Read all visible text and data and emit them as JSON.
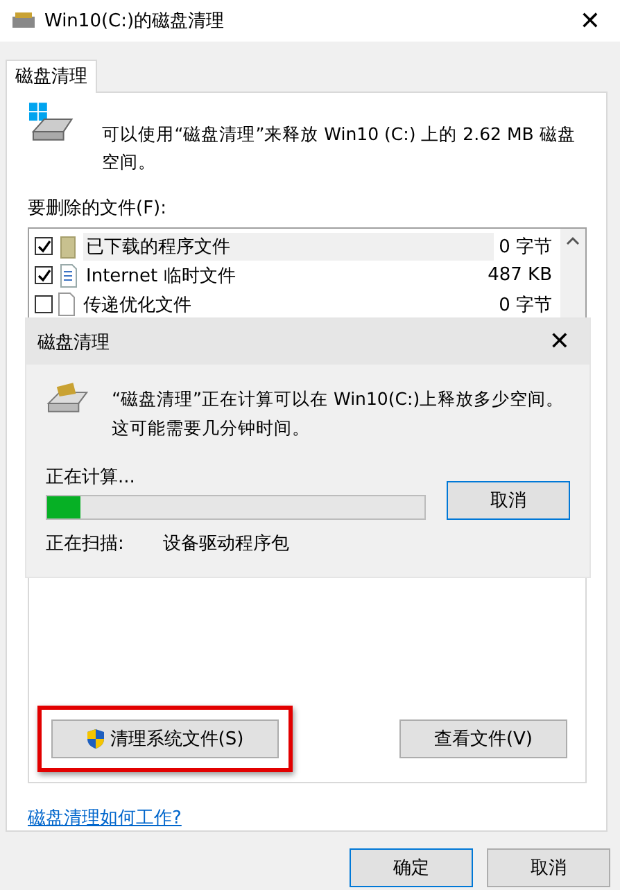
{
  "window": {
    "title": "Win10(C:)的磁盘清理",
    "close": "✕"
  },
  "tabs": [
    {
      "label": "磁盘清理",
      "selected": true
    }
  ],
  "summary": "可以使用“磁盘清理”来释放 Win10 (C:) 上的 2.62 MB 磁盘空间。",
  "files_label": "要删除的文件(F):",
  "files": [
    {
      "name": "已下载的程序文件",
      "size": "0 字节",
      "checked": true,
      "selected": true,
      "kind": "folder"
    },
    {
      "name": "Internet 临时文件",
      "size": "487 KB",
      "checked": true,
      "selected": false,
      "kind": "web"
    },
    {
      "name": "传递优化文件",
      "size": "0 字节",
      "checked": false,
      "selected": false,
      "kind": "page"
    }
  ],
  "actions": [
    {
      "label": "清理系统文件(S)",
      "shield": true,
      "highlighted": true
    },
    {
      "label": "查看文件(V)",
      "shield": false,
      "highlighted": false
    }
  ],
  "help_link": "磁盘清理如何工作?",
  "buttons": [
    {
      "label": "确定",
      "default": true
    },
    {
      "label": "取消",
      "default": false
    }
  ],
  "progress_dialog": {
    "title": "磁盘清理",
    "close": "✕",
    "message": "“磁盘清理”正在计算可以在 Win10(C:)上释放多少空间。这可能需要几分钟时间。",
    "status": "正在计算...",
    "level": 0.09,
    "cancel": "取消",
    "scanning_label": "正在扫描:",
    "scanning_item": "设备驱动程序包"
  }
}
